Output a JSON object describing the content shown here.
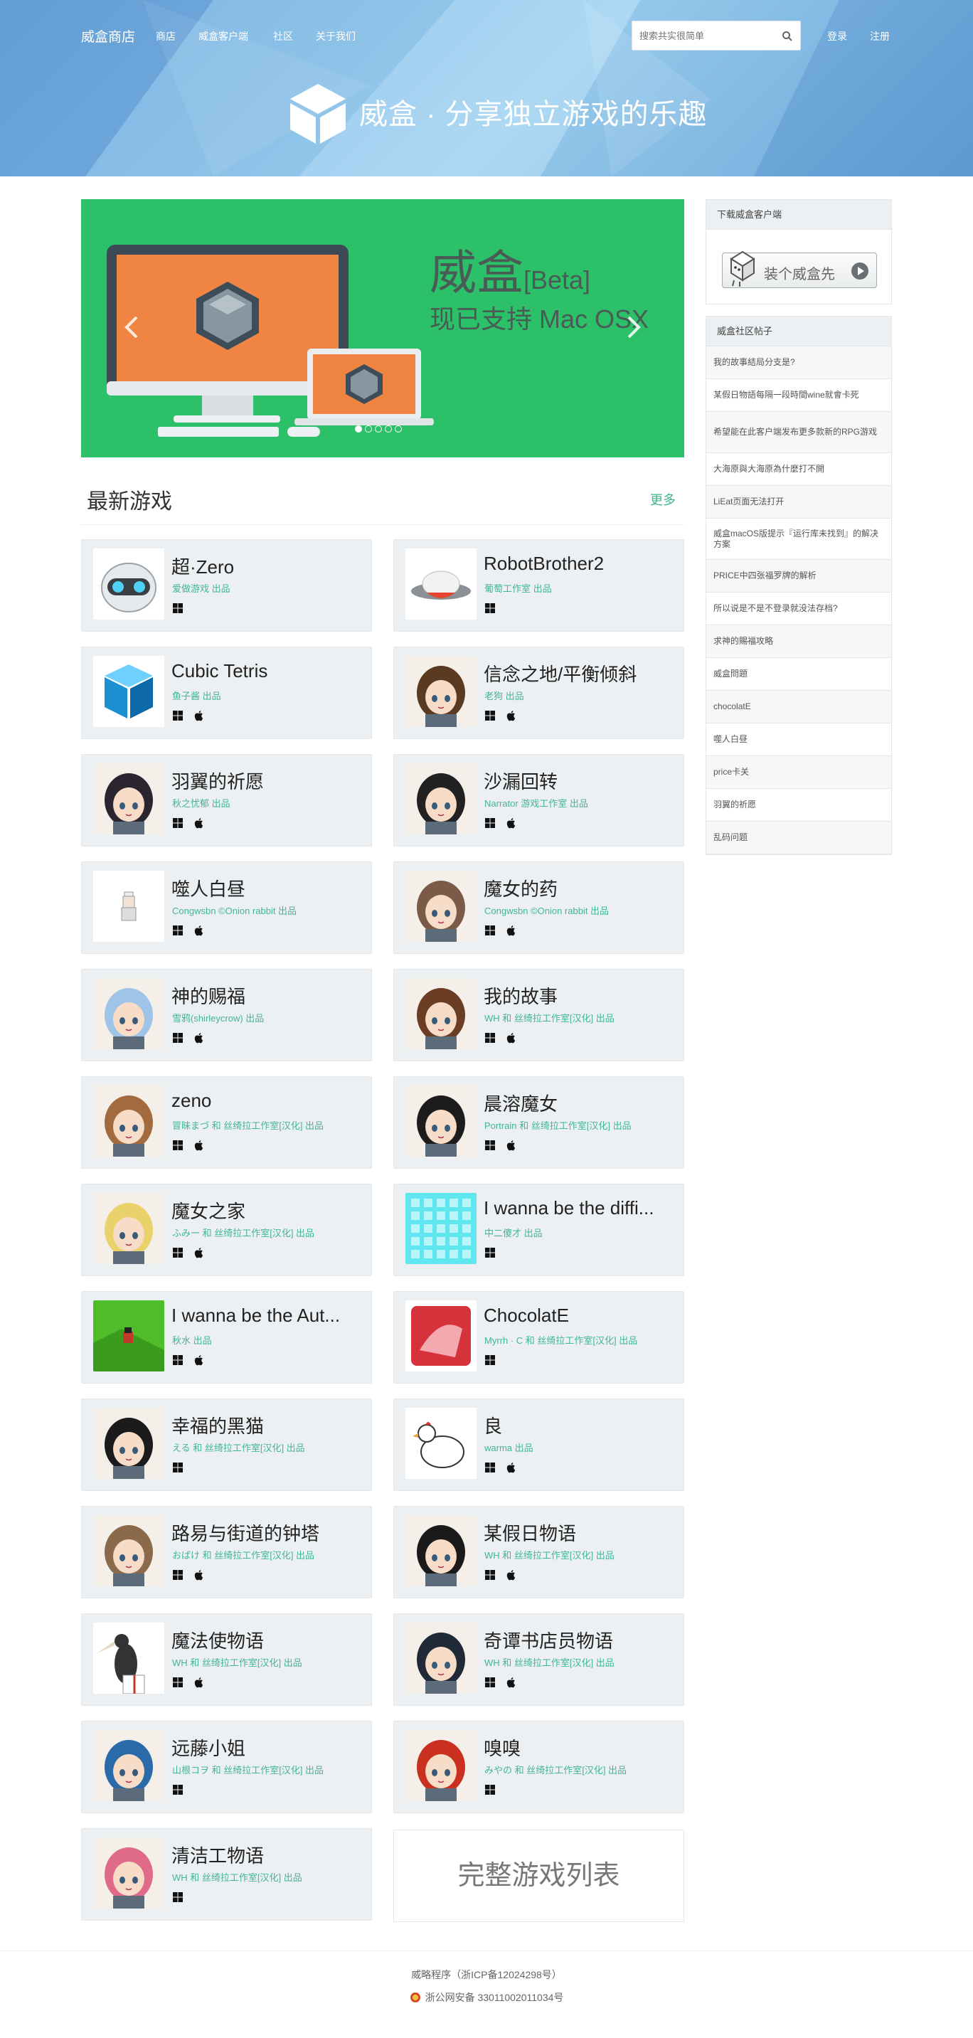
{
  "nav": {
    "brand": "威盒商店",
    "links": [
      "商店",
      "威盒客户端",
      "社区",
      "关于我们"
    ],
    "search_placeholder": "搜索共实很简单",
    "login": "登录",
    "register": "注册"
  },
  "hero": {
    "tagline": "威盒 · 分享独立游戏的乐趣"
  },
  "carousel": {
    "title": "威盒",
    "title_suffix": "[Beta]",
    "subtitle": "现已支持 Mac OSX",
    "slides": 5,
    "active_slide": 1
  },
  "section": {
    "title": "最新游戏",
    "more": "更多"
  },
  "games": [
    {
      "name": "超·Zero",
      "maker": "爱做游戏 出品",
      "platforms": [
        "windows"
      ],
      "thumb": "robot",
      "color": "#bfc6cc"
    },
    {
      "name": "RobotBrother2",
      "maker": "葡萄工作室 出品",
      "platforms": [
        "windows"
      ],
      "thumb": "saucer",
      "color": "#e0e0e0"
    },
    {
      "name": "Cubic Tetris",
      "maker": "鱼子酱 出品",
      "platforms": [
        "windows",
        "apple"
      ],
      "thumb": "cube",
      "color": "#2aa7e6"
    },
    {
      "name": "信念之地/平衡倾斜",
      "maker": "老狗 出品",
      "platforms": [
        "windows",
        "apple"
      ],
      "thumb": "fidelis",
      "color": "#5b3a22"
    },
    {
      "name": "羽翼的祈愿",
      "maker": "秋之忧郁 出品",
      "platforms": [
        "windows",
        "apple"
      ],
      "thumb": "girl",
      "color": "#2b2530"
    },
    {
      "name": "沙漏回转",
      "maker": "Narrator 游戏工作室 出品",
      "platforms": [
        "windows",
        "apple"
      ],
      "thumb": "hourglass",
      "color": "#222222"
    },
    {
      "name": "噬人白昼",
      "maker": "Congwsbn ©Onion rabbit 出品",
      "platforms": [
        "windows",
        "apple"
      ],
      "thumb": "sprite",
      "color": "#f3f3f3"
    },
    {
      "name": "魔女的药",
      "maker": "Congwsbn ©Onion rabbit 出品",
      "platforms": [
        "windows",
        "apple"
      ],
      "thumb": "potion",
      "color": "#7b5b48"
    },
    {
      "name": "神的赐福",
      "maker": "雪鸦(shirleycrow) 出品",
      "platforms": [
        "windows",
        "apple"
      ],
      "thumb": "angels",
      "color": "#9fc4e8"
    },
    {
      "name": "我的故事",
      "maker": "WH 和 丝绮拉工作室[汉化] 出品",
      "platforms": [
        "windows",
        "apple"
      ],
      "thumb": "boy",
      "color": "#6b3d24"
    },
    {
      "name": "zeno",
      "maker": "冒昧まづ 和 丝绮拉工作室[汉化] 出品",
      "platforms": [
        "windows",
        "apple"
      ],
      "thumb": "duo",
      "color": "#a26b3f"
    },
    {
      "name": "晨溶魔女",
      "maker": "Portrain 和 丝绮拉工作室[汉化] 出品",
      "platforms": [
        "windows",
        "apple"
      ],
      "thumb": "witch",
      "color": "#1c1c1c"
    },
    {
      "name": "魔女之家",
      "maker": "ふみー 和 丝绮拉工作室[汉化] 出品",
      "platforms": [
        "windows",
        "apple"
      ],
      "thumb": "blonde",
      "color": "#e9d26a"
    },
    {
      "name": "I wanna be the diffi...",
      "maker": "中二傻才 出品",
      "platforms": [
        "windows"
      ],
      "thumb": "grid",
      "color": "#5fe6ee"
    },
    {
      "name": "I wanna be the Aut...",
      "maker": "秋水 出品",
      "platforms": [
        "windows",
        "apple"
      ],
      "thumb": "green",
      "color": "#4fbd2a"
    },
    {
      "name": "ChocolatE",
      "maker": "Myrrh · C 和 丝绮拉工作室[汉化] 出品",
      "platforms": [
        "windows"
      ],
      "thumb": "choco",
      "color": "#d6323b"
    },
    {
      "name": "幸福的黑猫",
      "maker": "える 和 丝绮拉工作室[汉化] 出品",
      "platforms": [
        "windows"
      ],
      "thumb": "redhood",
      "color": "#1b1b1b"
    },
    {
      "name": "良",
      "maker": "warma 出品",
      "platforms": [
        "windows",
        "apple"
      ],
      "thumb": "chicken",
      "color": "#ffffff"
    },
    {
      "name": "路易与街道的钟塔",
      "maker": "おばけ 和 丝绮拉工作室[汉化] 出品",
      "platforms": [
        "windows",
        "apple"
      ],
      "thumb": "hat",
      "color": "#8a6a4a"
    },
    {
      "name": "某假日物语",
      "maker": "WH 和 丝绮拉工作室[汉化] 出品",
      "platforms": [
        "windows",
        "apple"
      ],
      "thumb": "mask",
      "color": "#1a1a1a"
    },
    {
      "name": "魔法使物语",
      "maker": "WH 和 丝绮拉工作室[汉化] 出品",
      "platforms": [
        "windows",
        "apple"
      ],
      "thumb": "bird",
      "color": "#333333"
    },
    {
      "name": "奇谭书店员物语",
      "maker": "WH 和 丝绮拉工作室[汉化] 出品",
      "platforms": [
        "windows",
        "apple"
      ],
      "thumb": "clerk",
      "color": "#1f2a36"
    },
    {
      "name": "远藤小姐",
      "maker": "山根コヲ 和 丝绮拉工作室[汉化] 出品",
      "platforms": [
        "windows"
      ],
      "thumb": "endo",
      "color": "#2a6aa8"
    },
    {
      "name": "嗅嗅",
      "maker": "みやの 和 丝绮拉工作室[汉化] 出品",
      "platforms": [
        "windows"
      ],
      "thumb": "redhair",
      "color": "#c93020"
    },
    {
      "name": "清洁工物语",
      "maker": "WH 和 丝绮拉工作室[汉化] 出品",
      "platforms": [
        "windows"
      ],
      "thumb": "gasmask",
      "color": "#e06a8a"
    }
  ],
  "full_list": "完整游戏列表",
  "sidebar": {
    "client_title": "下载威盒客户端",
    "client_button": "装个威盒先",
    "forum_title": "威盒社区帖子",
    "posts": [
      "我的故事結局分支是?",
      "某假日物語每隔一段時間wine就會卡死",
      "希望能在此客户端发布更多款新的RPG游戏",
      "大海原與大海原為什麼打不開",
      "LiEat页面无法打开",
      "威盒macOS版提示『运行库未找到』的解决方案",
      "PRICE中四张福罗牌的解析",
      "所以说是不是不登录就没法存档?",
      "求神的賜福攻略",
      "威盒問題",
      "chocolatE",
      "噬人白昼",
      "price卡关",
      "羽翼的祈愿",
      "乱码问题"
    ]
  },
  "footer": {
    "icp": "威略程序（浙ICP备12024298号）",
    "police": "浙公网安备 33011002011034号"
  },
  "colors": {
    "accent": "#3fb58f",
    "carousel_bg": "#2cc069",
    "card_bg": "#edf0f2"
  }
}
